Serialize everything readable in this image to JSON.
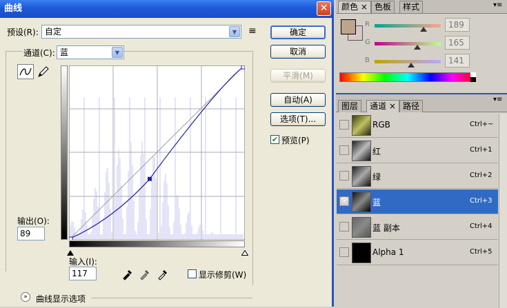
{
  "dialog": {
    "title": "曲线",
    "close_glyph": "✕",
    "preset_label": "预设(R):",
    "preset_value": "自定",
    "preset_menu_glyph": "≡",
    "channel_label": "通道(C):",
    "channel_value": "蓝",
    "output_label": "输出(O):",
    "output_value": "89",
    "input_label": "输入(I):",
    "input_value": "117",
    "show_clipping_label": "显示修剪(W)",
    "show_clipping_checked": false,
    "preview_label": "预览(P)",
    "preview_checked": true,
    "curve_display_label": "曲线显示选项",
    "buttons": {
      "ok": "确定",
      "cancel": "取消",
      "smooth": "平滑(M)",
      "auto": "自动(A)",
      "options": "选项(T)..."
    }
  },
  "colors_panel": {
    "tabs": [
      "颜色",
      "色板",
      "样式"
    ],
    "active_tab": "颜色",
    "channels": [
      {
        "label": "R",
        "value": "189",
        "level": 0.74
      },
      {
        "label": "G",
        "value": "165",
        "level": 0.65
      },
      {
        "label": "B",
        "value": "141",
        "level": 0.55
      }
    ],
    "foreground_color": "#bda58d",
    "background_color": "#d8c8c8"
  },
  "channels_panel": {
    "tabs": [
      "图层",
      "通道",
      "路径"
    ],
    "active_tab": "通道",
    "rows": [
      {
        "name": "RGB",
        "shortcut": "Ctrl+~",
        "visible": false,
        "selected": false
      },
      {
        "name": "红",
        "shortcut": "Ctrl+1",
        "visible": false,
        "selected": false
      },
      {
        "name": "绿",
        "shortcut": "Ctrl+2",
        "visible": false,
        "selected": false
      },
      {
        "name": "蓝",
        "shortcut": "Ctrl+3",
        "visible": true,
        "selected": true
      },
      {
        "name": "蓝 副本",
        "shortcut": "Ctrl+4",
        "visible": false,
        "selected": false
      },
      {
        "name": "Alpha 1",
        "shortcut": "Ctrl+5",
        "visible": false,
        "selected": false
      }
    ]
  },
  "curve": {
    "control_point": {
      "input": 117,
      "output": 89
    },
    "accent": "#1f1fa8"
  }
}
